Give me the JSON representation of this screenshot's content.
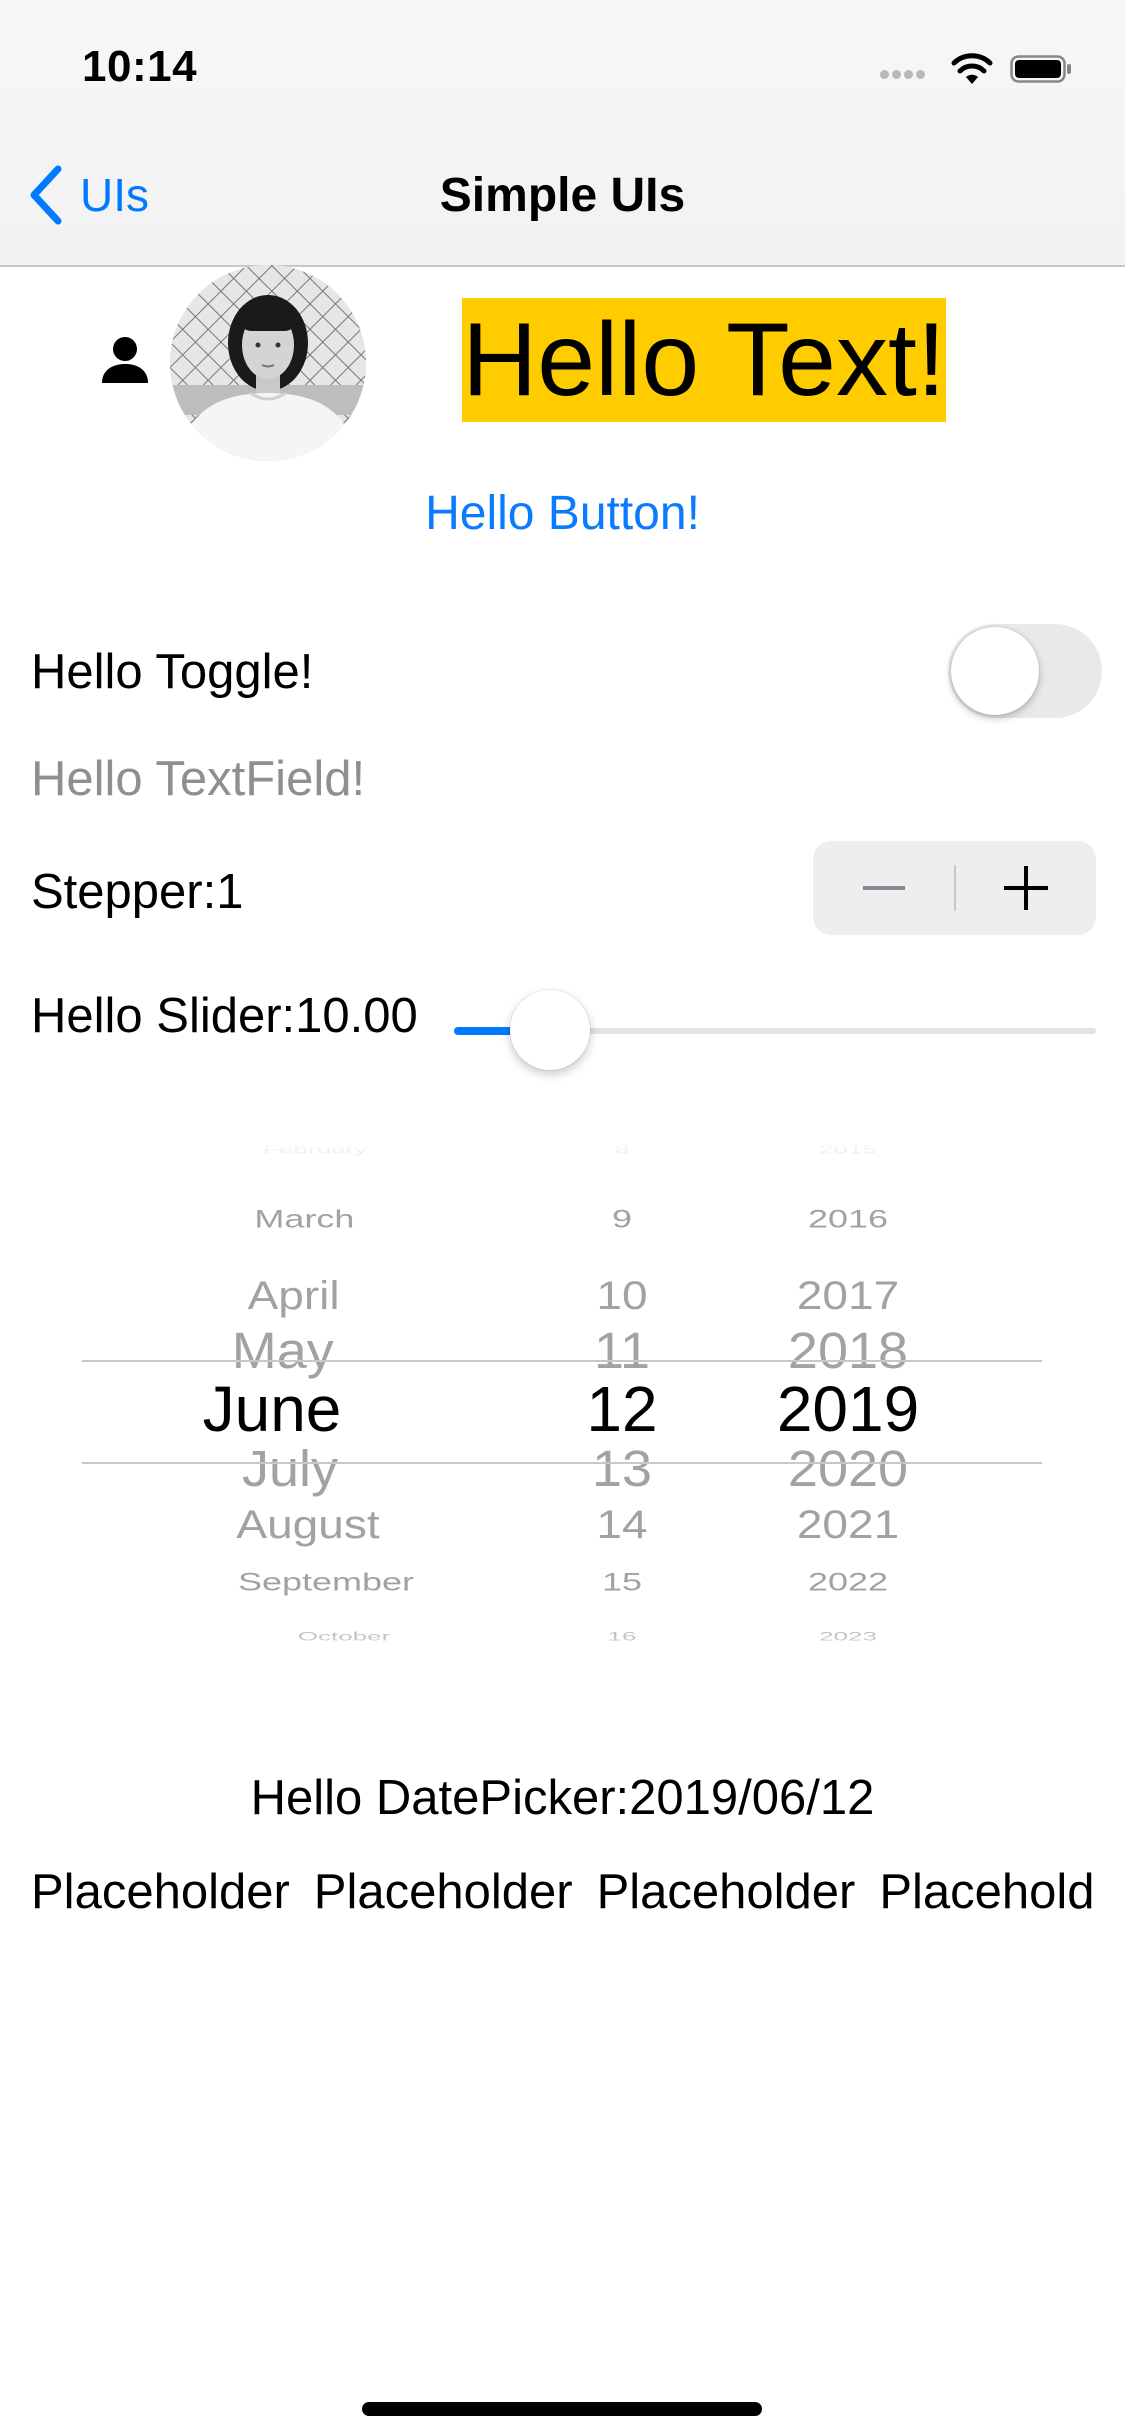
{
  "status_bar": {
    "time": "10:14",
    "icons": [
      "cellular-signal-icon",
      "wifi-icon",
      "battery-icon"
    ]
  },
  "nav": {
    "back_label": "UIs",
    "back_icon": "chevron-left-icon",
    "title": "Simple UIs"
  },
  "header": {
    "person_icon": "person-fill-icon",
    "avatar": "profile-photo",
    "hello_text": "Hello Text!",
    "hello_text_bg": "#ffcc00"
  },
  "button": {
    "label": "Hello Button!",
    "color": "#007aff"
  },
  "toggle": {
    "label": "Hello Toggle!",
    "on": false
  },
  "textfield": {
    "placeholder": "Hello TextField!",
    "value": ""
  },
  "stepper": {
    "label": "Stepper:1",
    "value": 1,
    "minus_icon": "minus-icon",
    "plus_icon": "plus-icon"
  },
  "slider": {
    "label": "Hello Slider:10.00",
    "value": 10.0,
    "fraction": 0.1,
    "accent": "#007aff"
  },
  "date_picker": {
    "months": [
      "February",
      "March",
      "April",
      "May",
      "June",
      "July",
      "August",
      "September",
      "October"
    ],
    "days": [
      "8",
      "9",
      "10",
      "11",
      "12",
      "13",
      "14",
      "15",
      "16"
    ],
    "years": [
      "2015",
      "2016",
      "2017",
      "2018",
      "2019",
      "2020",
      "2021",
      "2022",
      "2023"
    ],
    "selected_month": "June",
    "selected_day": "12",
    "selected_year": "2019"
  },
  "date_label": "Hello DatePicker:2019/06/12",
  "placeholders": [
    "Placeholder",
    "Placeholder",
    "Placeholder",
    "Placeholder"
  ]
}
